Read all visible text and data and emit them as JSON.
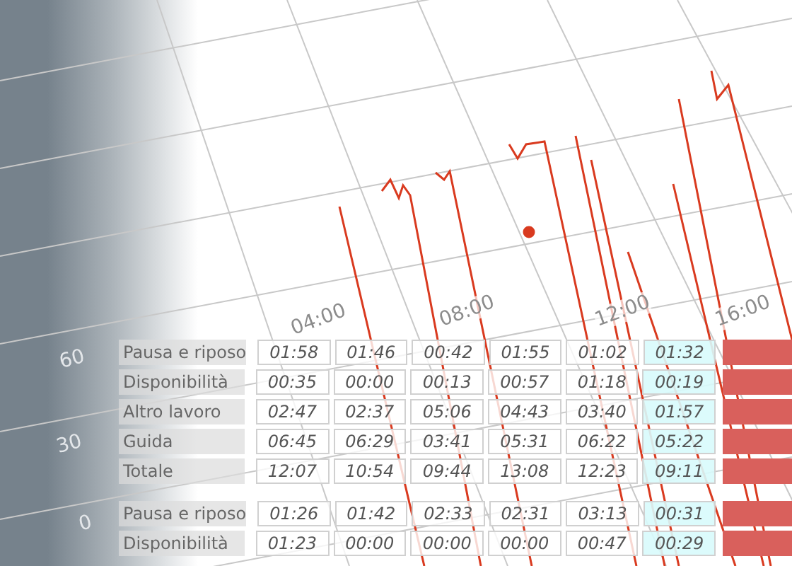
{
  "chart": {
    "axis_labels": [
      {
        "text": "60",
        "kind": "y"
      },
      {
        "text": "30",
        "kind": "y"
      },
      {
        "text": "0",
        "kind": "y"
      },
      {
        "text": "04:00",
        "kind": "x"
      },
      {
        "text": "08:00",
        "kind": "x"
      },
      {
        "text": "12:00",
        "kind": "x"
      },
      {
        "text": "16:00",
        "kind": "x"
      }
    ]
  },
  "table": {
    "columns": [
      {
        "highlighted": false
      },
      {
        "highlighted": false
      },
      {
        "highlighted": false
      },
      {
        "highlighted": false
      },
      {
        "highlighted": false
      },
      {
        "highlighted": true
      }
    ],
    "groups": [
      {
        "rows": [
          {
            "label": "Pausa e riposo",
            "values": [
              "01:58",
              "01:46",
              "00:42",
              "01:55",
              "01:02",
              "01:32"
            ]
          },
          {
            "label": "Disponibilità",
            "values": [
              "00:35",
              "00:00",
              "00:13",
              "00:57",
              "01:18",
              "00:19"
            ]
          },
          {
            "label": "Altro lavoro",
            "values": [
              "02:47",
              "02:37",
              "05:06",
              "04:43",
              "03:40",
              "01:57"
            ]
          },
          {
            "label": "Guida",
            "values": [
              "06:45",
              "06:29",
              "03:41",
              "05:31",
              "06:22",
              "05:22"
            ]
          },
          {
            "label": "Totale",
            "values": [
              "12:07",
              "10:54",
              "09:44",
              "13:08",
              "12:23",
              "09:11"
            ]
          }
        ]
      },
      {
        "rows": [
          {
            "label": "Pausa e riposo",
            "values": [
              "01:26",
              "01:42",
              "02:33",
              "02:31",
              "03:13",
              "00:31"
            ]
          },
          {
            "label": "Disponibilità",
            "values": [
              "01:23",
              "00:00",
              "00:00",
              "00:00",
              "00:47",
              "00:29"
            ]
          }
        ]
      }
    ]
  }
}
